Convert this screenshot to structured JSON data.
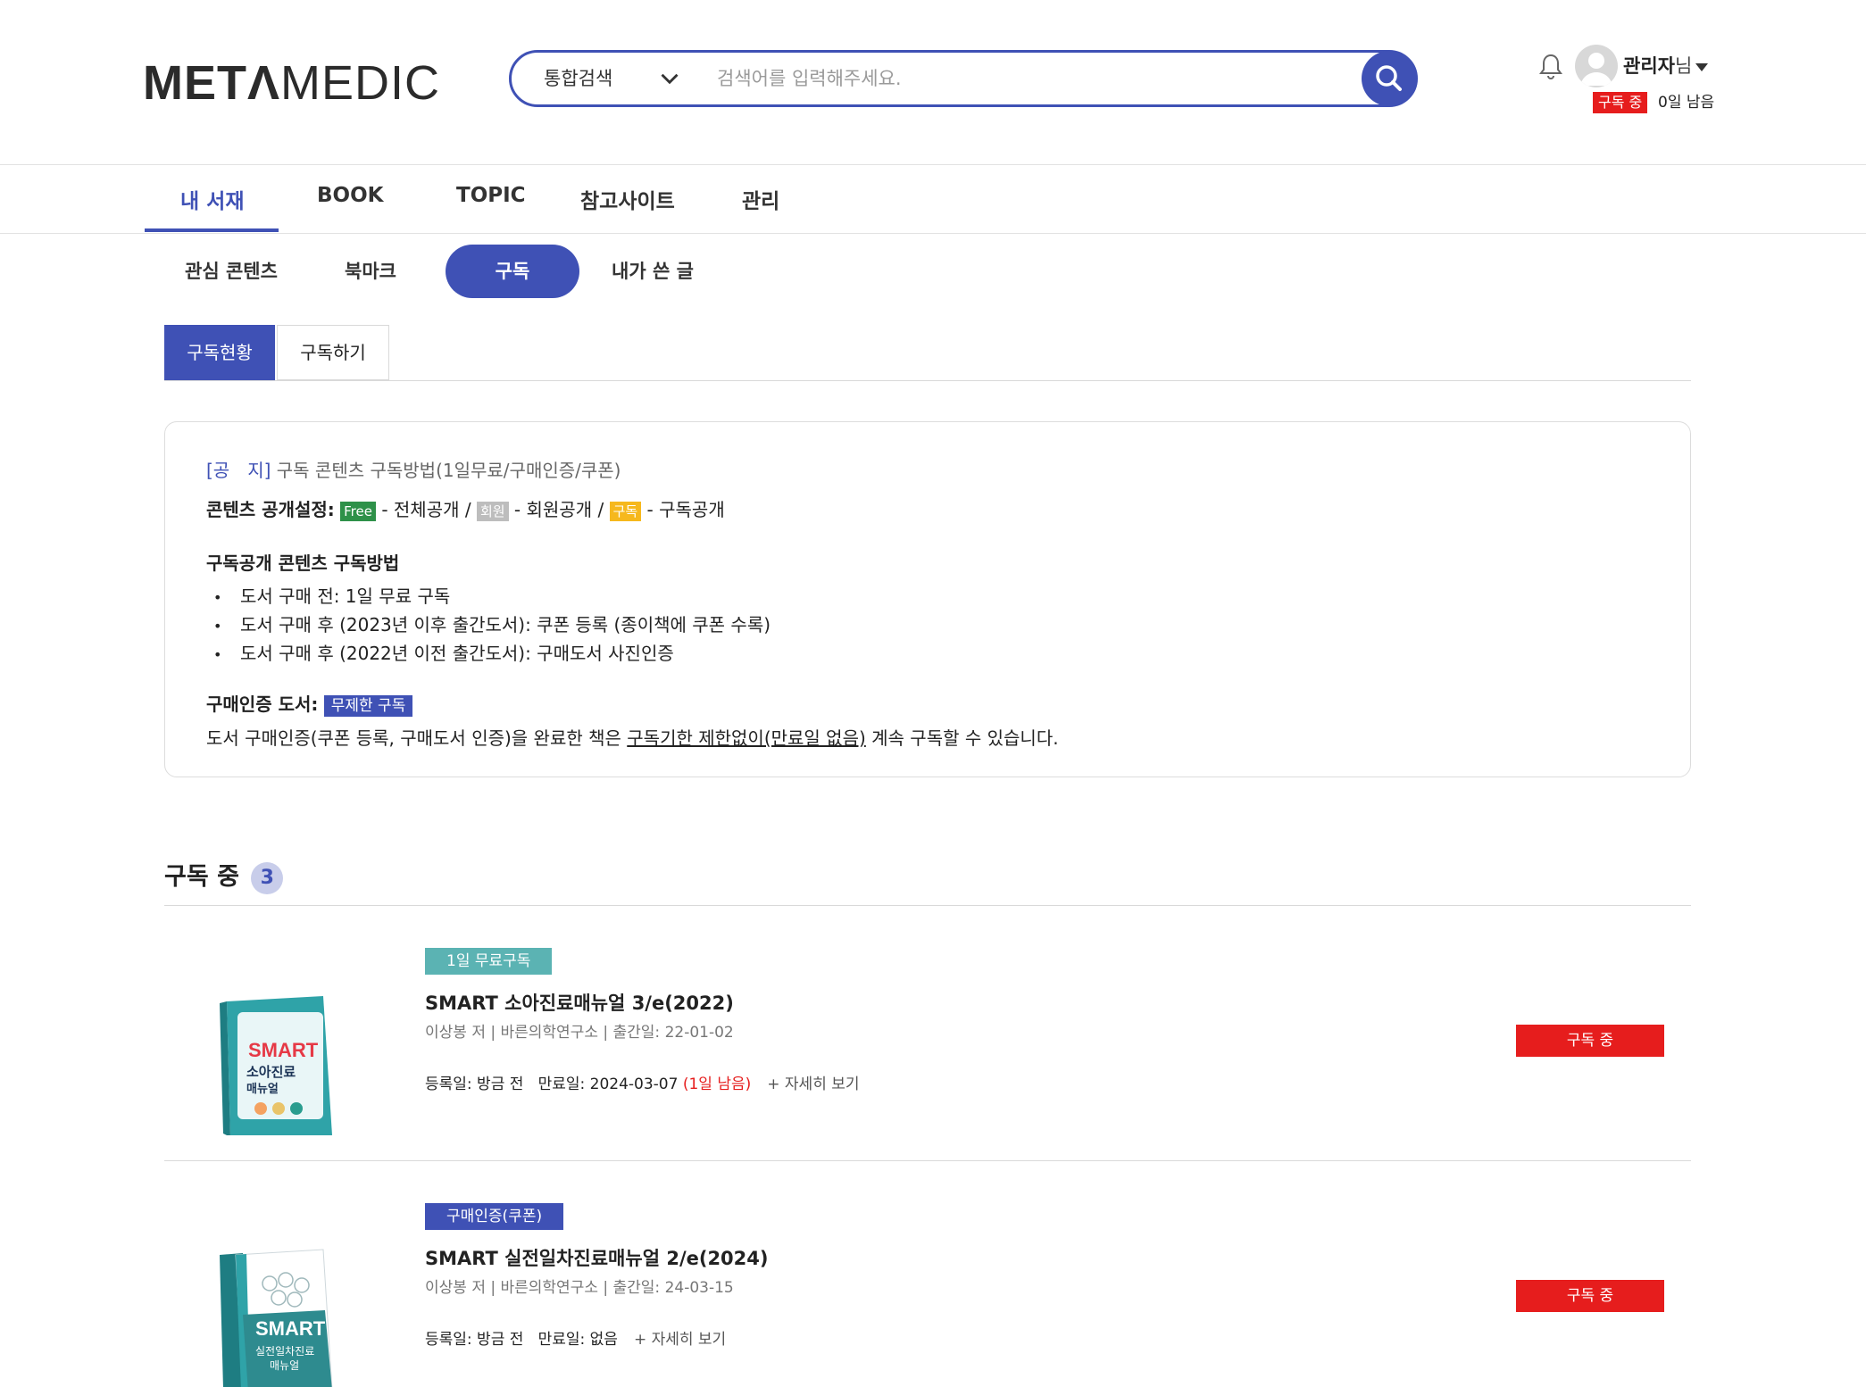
{
  "header": {
    "logo_bold": "METΛ",
    "logo_light": "MEDIC",
    "search": {
      "scope": "통합검색",
      "placeholder": "검색어를 입력해주세요."
    },
    "user": {
      "name": "관리자",
      "suffix": "님",
      "status_badge": "구독 중",
      "days_left": "0일 남음"
    }
  },
  "nav": {
    "items": [
      {
        "label": "내 서재"
      },
      {
        "label": "BOOK"
      },
      {
        "label": "TOPIC"
      },
      {
        "label": "참고사이트"
      },
      {
        "label": "관리"
      }
    ]
  },
  "subnav": {
    "items": [
      {
        "label": "관심 콘텐츠"
      },
      {
        "label": "북마크"
      },
      {
        "label": "구독"
      },
      {
        "label": "내가 쓴 글"
      }
    ]
  },
  "tabs": {
    "status": "구독현황",
    "subscribe": "구독하기"
  },
  "notice": {
    "label": "[공　지]",
    "title": "구독 콘텐츠 구독방법(1일무료/구매인증/쿠폰)",
    "settings_label": "콘텐츠 공개설정:",
    "tag_free": "Free",
    "text_free": " - 전체공개 / ",
    "tag_member": "회원",
    "text_member": " - 회원공개 / ",
    "tag_sub": "구독",
    "text_sub": " - 구독공개",
    "method_title": "구독공개 콘텐츠 구독방법",
    "bullets": [
      "도서 구매 전: 1일 무료 구독",
      "도서 구매 후 (2023년 이후 출간도서): 쿠폰 등록 (종이책에 쿠폰 수록)",
      "도서 구매 후 (2022년 이전 출간도서): 구매도서 사진인증"
    ],
    "verified_label": "구매인증 도서:",
    "verified_tag": "무제한 구독",
    "verified_text_1": "도서 구매인증(쿠폰 등록, 구매도서 인증)을 완료한 책은 ",
    "verified_text_link": "구독기한 제한없이(만료일 없음)",
    "verified_text_2": " 계속 구독할 수 있습니다."
  },
  "section": {
    "title": "구독 중",
    "count": "3"
  },
  "books": [
    {
      "tag": "1일 무료구독",
      "tag_color": "#5bb3b3",
      "title": "SMART 소아진료매뉴얼 3/e(2022)",
      "meta": "이상봉 저 | 바른의학연구소 | 출간일: 22-01-02",
      "registered": "등록일: 방금 전",
      "expires": "만료일: 2024-03-07",
      "remaining": "(1일 남음)",
      "more": "+ 자세히 보기",
      "status": "구독 중"
    },
    {
      "tag": "구매인증(쿠폰)",
      "tag_color": "#3f51b5",
      "title": "SMART 실전일차진료매뉴얼 2/e(2024)",
      "meta": "이상봉 저 | 바른의학연구소 | 출간일: 24-03-15",
      "registered": "등록일: 방금 전",
      "expires": "만료일: 없음",
      "remaining": "",
      "more": "+ 자세히 보기",
      "status": "구독 중"
    }
  ],
  "colors": {
    "primary": "#3f51b5",
    "red": "#e61d1d",
    "teal": "#5bb3b3"
  }
}
